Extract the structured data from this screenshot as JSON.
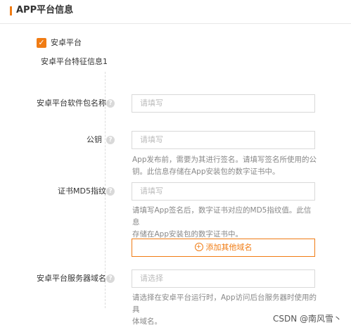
{
  "section": {
    "title": "APP平台信息"
  },
  "platform": {
    "checkbox_label": "安卓平台",
    "checked": true,
    "feature_title": "安卓平台特征信息1"
  },
  "fields": {
    "package_name": {
      "label": "安卓平台软件包名称",
      "placeholder": "请填写"
    },
    "public_key": {
      "label": "公钥",
      "placeholder": "请填写",
      "hint_line1": "App发布前，需要为其进行签名。请填写签名所使用的公",
      "hint_line2": "钥。此信息存储在App安装包的数字证书中。"
    },
    "cert_md5": {
      "label": "证书MD5指纹",
      "placeholder": "请填写",
      "hint_line1": "请填写App签名后，数字证书对应的MD5指纹值。此信息",
      "hint_line2": "存储在App安装包的数字证书中。"
    },
    "server_domain": {
      "label": "安卓平台服务器域名",
      "placeholder": "请选择",
      "hint_line1": "请选择在安卓平台运行时，App访问后台服务器时使用的具",
      "hint_line2": "体域名。"
    }
  },
  "add_domain_button": {
    "icon": "plus-circle-icon",
    "label": "添加其他域名"
  },
  "watermark": "CSDN @南风雪丶",
  "colors": {
    "accent": "#f07c14",
    "border": "#d9d9d9",
    "hint": "#888888"
  }
}
